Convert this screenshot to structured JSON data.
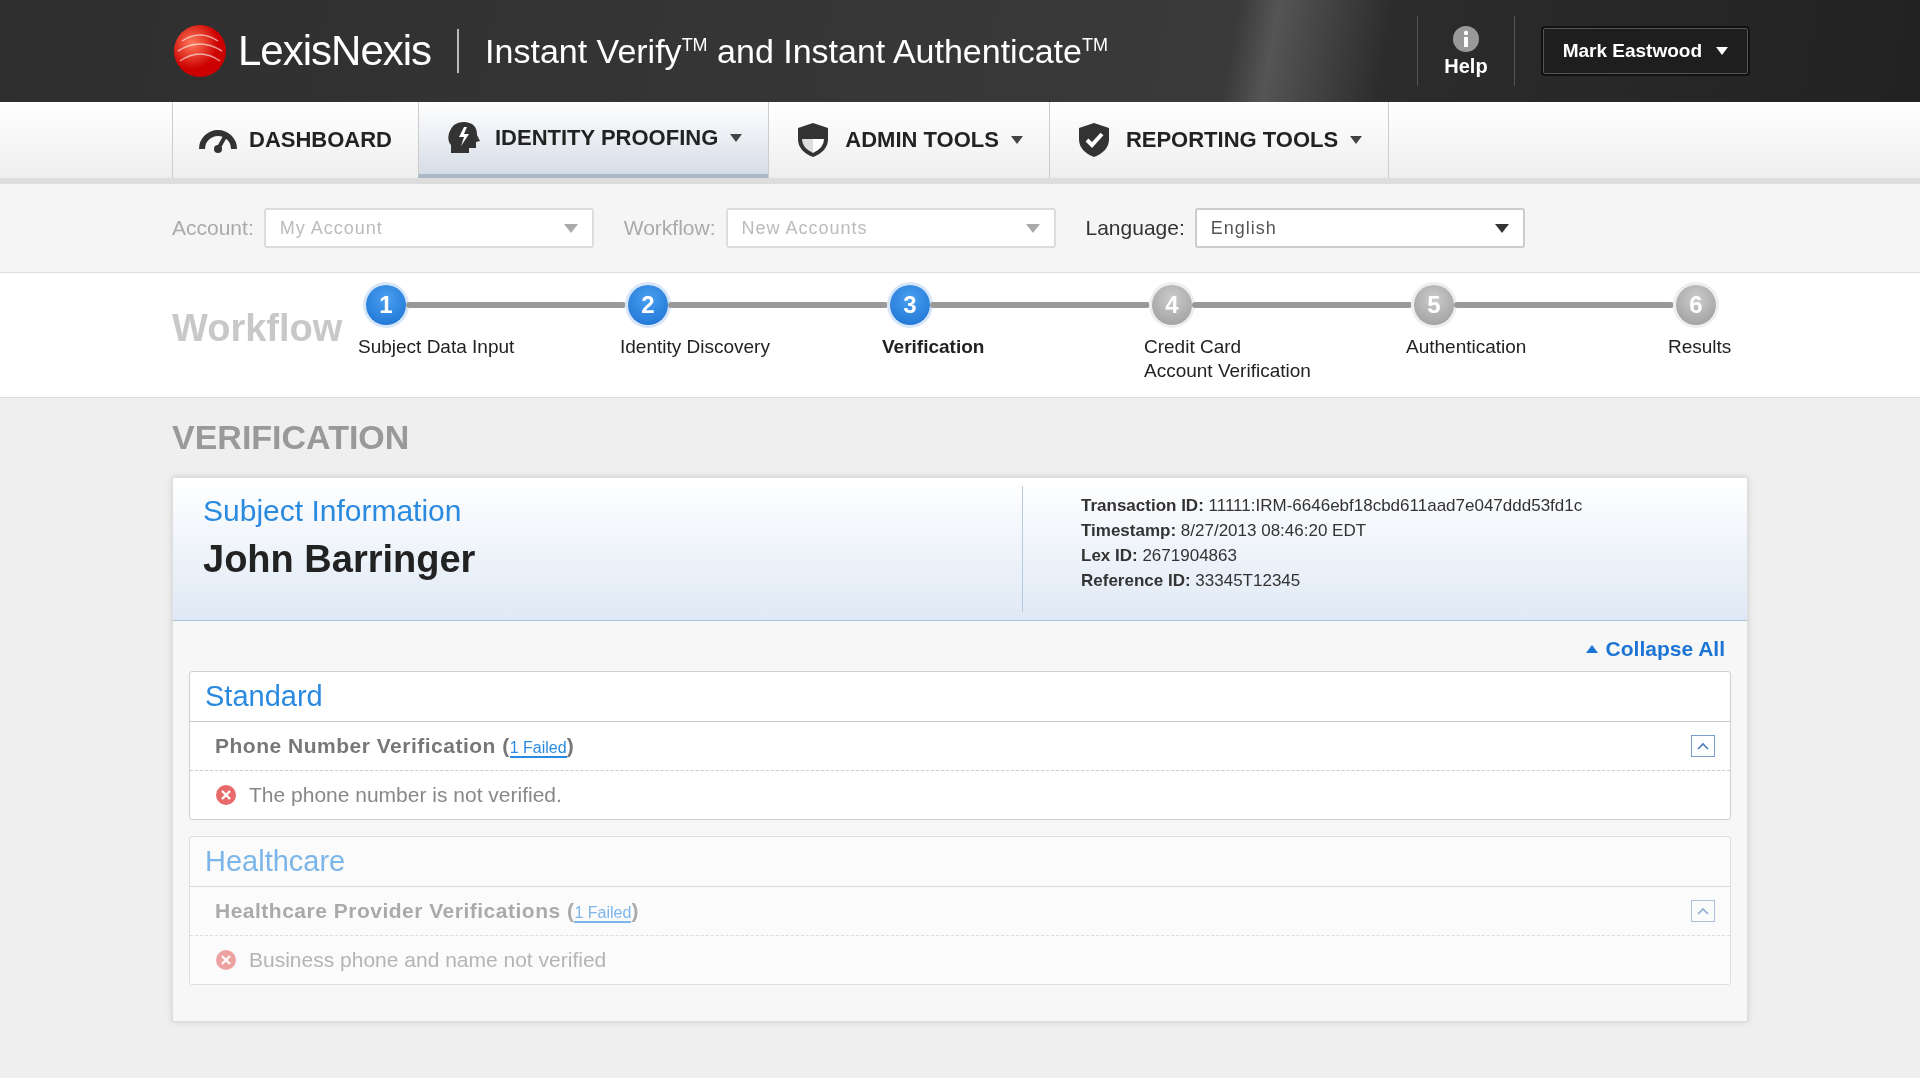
{
  "header": {
    "brand": "LexisNexis",
    "product": "Instant Verify",
    "product_mark": "TM",
    "product_rest": " and Instant Authenticate",
    "product_rest_mark": "TM",
    "help": "Help",
    "user": "Mark Eastwood"
  },
  "nav": [
    {
      "label": "DASHBOARD",
      "has_menu": false,
      "selected": false
    },
    {
      "label": "IDENTITY PROOFING",
      "has_menu": true,
      "selected": true
    },
    {
      "label": "ADMIN TOOLS",
      "has_menu": true,
      "selected": false
    },
    {
      "label": "REPORTING TOOLS",
      "has_menu": true,
      "selected": false
    }
  ],
  "filters": [
    {
      "label": "Account:",
      "value": "My Account",
      "disabled": true
    },
    {
      "label": "Workflow:",
      "value": "New Accounts",
      "disabled": true
    },
    {
      "label": "Language:",
      "value": "English",
      "disabled": false
    }
  ],
  "workflow": {
    "title": "Workflow",
    "steps": [
      {
        "number": "1",
        "label": "Subject Data Input",
        "reached": true,
        "selected": false
      },
      {
        "number": "2",
        "label": "Identity Discovery",
        "reached": true,
        "selected": false
      },
      {
        "number": "3",
        "label": "Verification",
        "reached": true,
        "selected": true
      },
      {
        "number": "4",
        "label": "Credit Card\nAccount Verification",
        "reached": false,
        "selected": false
      },
      {
        "number": "5",
        "label": "Authentication",
        "reached": false,
        "selected": false
      },
      {
        "number": "6",
        "label": "Results",
        "reached": false,
        "selected": false
      }
    ]
  },
  "page_title": "VERIFICATION",
  "subject": {
    "heading": "Subject Information",
    "name": "John Barringer",
    "details": [
      {
        "label": "Transaction ID:",
        "value": "11111:IRM-6646ebf18cbd611aad7e047ddd53fd1c"
      },
      {
        "label": "Timestamp:",
        "value": "8/27/2013  08:46:20 EDT"
      },
      {
        "label": "Lex ID:",
        "value": "2671904863"
      },
      {
        "label": "Reference ID:",
        "value": "33345T12345"
      }
    ]
  },
  "collapse_all": "Collapse All",
  "sections": [
    {
      "title": "Standard",
      "faded": false,
      "checks": [
        {
          "name": "Phone Number Verification (",
          "failed": "1 Failed",
          "close": ")",
          "expanded": true,
          "messages": [
            "The phone number is not verified."
          ]
        }
      ]
    },
    {
      "title": "Healthcare",
      "faded": true,
      "checks": [
        {
          "name": "Healthcare Provider Verifications (",
          "failed": "1 Failed",
          "close": ")",
          "expanded": true,
          "messages": [
            "Business phone and name not verified"
          ]
        }
      ]
    }
  ]
}
